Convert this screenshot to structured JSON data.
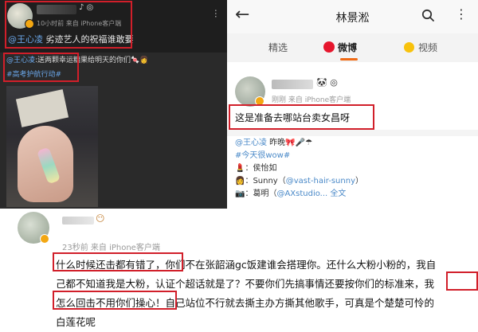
{
  "left_post": {
    "name_icons": "♪ ◎",
    "meta": "10小时前  来自 iPhone客户端",
    "mention": "@王心凌",
    "text": " 劣迹艺人的祝福谁敢要",
    "more_icon": "···",
    "repost_mention": "@王心凌",
    "repost_text": ":送两颗幸运糖果给明天的你们🍬👩",
    "topic": "#高考护航行动#"
  },
  "right_panel": {
    "title": "林景淞",
    "back_icon": "←",
    "more_icon": "⋮",
    "tabs": [
      {
        "label": "精选"
      },
      {
        "label": "微博"
      },
      {
        "label": "视频"
      }
    ],
    "post": {
      "name_icons": "🐼 ◎",
      "meta": "刚刚  来自 iPhone客户端",
      "text": "这是准备去哪站台卖女昌呀"
    },
    "repost": {
      "line1_mention": "@王心凌",
      "line1_rest": " 昨晚🎀🎤☂",
      "line2": "#今天很wow#",
      "line3": "💄：侯怡如",
      "line4_prefix": "👩：Sunny（",
      "line4_mention": "@vast-hair-sunny",
      "line4_suffix": "）",
      "line5_prefix": "📷：葛明（",
      "line5_mention": "@AXstudio...",
      "line5_suffix": " 全文"
    }
  },
  "comment": {
    "name_icon": "😶",
    "meta": "23秒前  来自 iPhone客户端",
    "line1": "什么时候还击都有错了，你们不在张韶涵gc饭建谁会搭理你。还什么大粉小粉的，我自",
    "line2": "己都不知道我是大粉，认证个超话就是了？不要你们先搞事情还要按你们的标准来，我",
    "line3": "怎么回击不用你们操心！自己站位不行就去撕主办方撕其他歌手，可真是个楚楚可怜的",
    "line4": "白莲花呢"
  },
  "colors": {
    "highlight_box": "#d11f2a",
    "mention_blue": "#4a89c8",
    "active_tab_underline": "#f06a15",
    "verified_badge": "#f3a712"
  }
}
